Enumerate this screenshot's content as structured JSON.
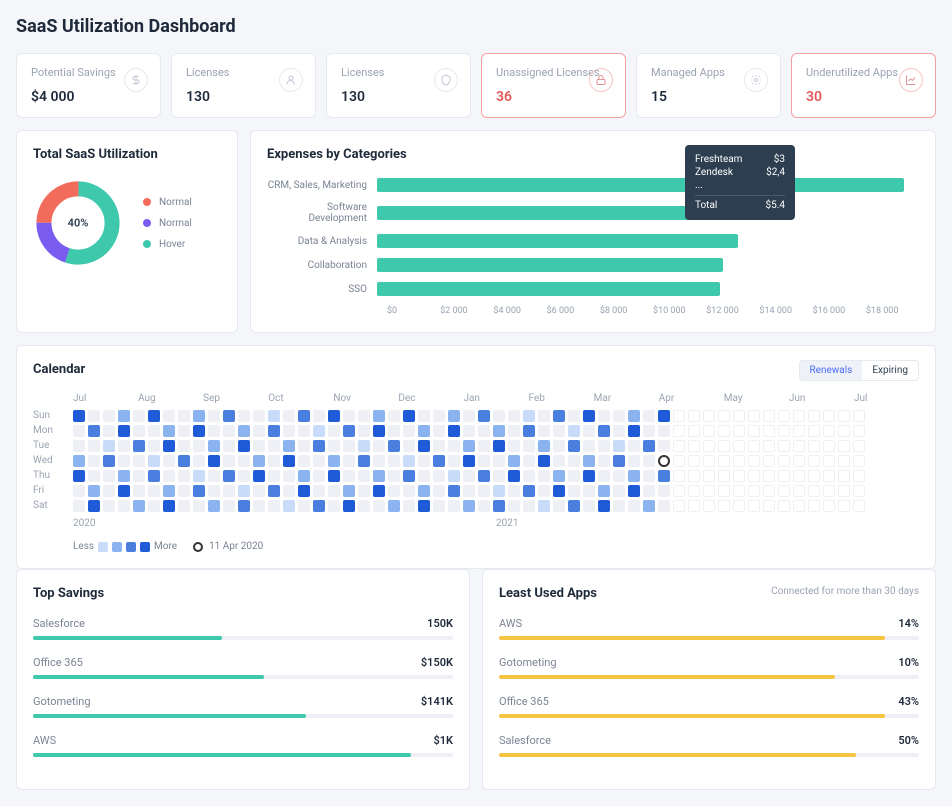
{
  "title": "SaaS Utilization Dashboard",
  "kpis": [
    {
      "label": "Potential Savings",
      "value": "$4 000",
      "warn": false,
      "icon": "dollar"
    },
    {
      "label": "Licenses",
      "value": "130",
      "warn": false,
      "icon": "user"
    },
    {
      "label": "Licenses",
      "value": "130",
      "warn": false,
      "icon": "shield"
    },
    {
      "label": "Unassigned Licenses",
      "value": "36",
      "warn": true,
      "icon": "lock"
    },
    {
      "label": "Managed Apps",
      "value": "15",
      "warn": false,
      "icon": "gear"
    },
    {
      "label": "Underutilized Apps",
      "value": "30",
      "warn": true,
      "icon": "chart"
    }
  ],
  "donut": {
    "title": "Total SaaS Utilization",
    "center": "40%",
    "legend": [
      {
        "label": "Normal",
        "color": "#f26b5b"
      },
      {
        "label": "Normal",
        "color": "#7a5cf0"
      },
      {
        "label": "Hover",
        "color": "#3ec8ac"
      }
    ]
  },
  "expenses": {
    "title": "Expenses by Categories",
    "axis": [
      "$0",
      "$2 000",
      "$4 000",
      "$6 000",
      "$8 000",
      "$10 000",
      "$12 000",
      "$14 000",
      "$16 000",
      "$18 000"
    ],
    "tooltip": {
      "rows": [
        {
          "k": "Freshteam",
          "v": "$3"
        },
        {
          "k": "Zendesk",
          "v": "$2,4"
        },
        {
          "k": "...",
          "v": ""
        }
      ],
      "total": {
        "k": "Total",
        "v": "$5.4"
      }
    }
  },
  "calendar": {
    "title": "Calendar",
    "tabs": [
      "Renewals",
      "Expiring"
    ],
    "months": [
      "Jul",
      "Aug",
      "Sep",
      "Oct",
      "Nov",
      "Dec",
      "Jan",
      "Feb",
      "Mar",
      "Apr",
      "May",
      "Jun",
      "Jul"
    ],
    "days": [
      "Sun",
      "Mon",
      "Tue",
      "Wed",
      "Thu",
      "Fri",
      "Sat"
    ],
    "years": [
      "2020",
      "2021"
    ],
    "legend": {
      "less": "Less",
      "more": "More",
      "today": "11 Apr 2020"
    }
  },
  "topSavings": {
    "title": "Top Savings",
    "rows": [
      {
        "name": "Salesforce",
        "value": "150K",
        "pct": 45
      },
      {
        "name": "Office 365",
        "value": "$150K",
        "pct": 55
      },
      {
        "name": "Gotometing",
        "value": "$141K",
        "pct": 65
      },
      {
        "name": "AWS",
        "value": "$1K",
        "pct": 90
      }
    ]
  },
  "leastUsed": {
    "title": "Least Used Apps",
    "note": "Connected for more than 30 days",
    "rows": [
      {
        "name": "AWS",
        "value": "14%",
        "pct": 92
      },
      {
        "name": "Gotometing",
        "value": "10%",
        "pct": 80
      },
      {
        "name": "Office 365",
        "value": "43%",
        "pct": 92
      },
      {
        "name": "Salesforce",
        "value": "50%",
        "pct": 85
      }
    ]
  },
  "chart_data": [
    {
      "type": "pie",
      "title": "Total SaaS Utilization",
      "series": [
        {
          "name": "Normal",
          "value": 25,
          "color": "#f26b5b"
        },
        {
          "name": "Normal",
          "value": 20,
          "color": "#7a5cf0"
        },
        {
          "name": "Hover",
          "value": 55,
          "color": "#3ec8ac"
        }
      ],
      "center_label": "40%"
    },
    {
      "type": "bar",
      "title": "Expenses by Categories",
      "orientation": "horizontal",
      "xlabel": "",
      "ylabel": "",
      "xlim": [
        0,
        18000
      ],
      "categories": [
        "CRM, Sales, Marketing",
        "Software Development",
        "Data & Analysis",
        "Collaboration",
        "SSO"
      ],
      "values": [
        17500,
        12800,
        12000,
        11500,
        11400
      ]
    },
    {
      "type": "heatmap",
      "title": "Calendar",
      "y": [
        "Sun",
        "Mon",
        "Tue",
        "Wed",
        "Thu",
        "Fri",
        "Sat"
      ],
      "x_range": "Jul 2020 – Jul 2021",
      "scale": [
        "Less",
        "More"
      ],
      "today": "11 Apr 2020"
    },
    {
      "type": "bar",
      "title": "Top Savings",
      "orientation": "horizontal",
      "categories": [
        "Salesforce",
        "Office 365",
        "Gotometing",
        "AWS"
      ],
      "values_label": [
        "150K",
        "$150K",
        "$141K",
        "$1K"
      ],
      "values": [
        45,
        55,
        65,
        90
      ]
    },
    {
      "type": "bar",
      "title": "Least Used Apps",
      "orientation": "horizontal",
      "categories": [
        "AWS",
        "Gotometing",
        "Office 365",
        "Salesforce"
      ],
      "values_label": [
        "14%",
        "10%",
        "43%",
        "50%"
      ],
      "values": [
        92,
        80,
        92,
        85
      ]
    }
  ]
}
